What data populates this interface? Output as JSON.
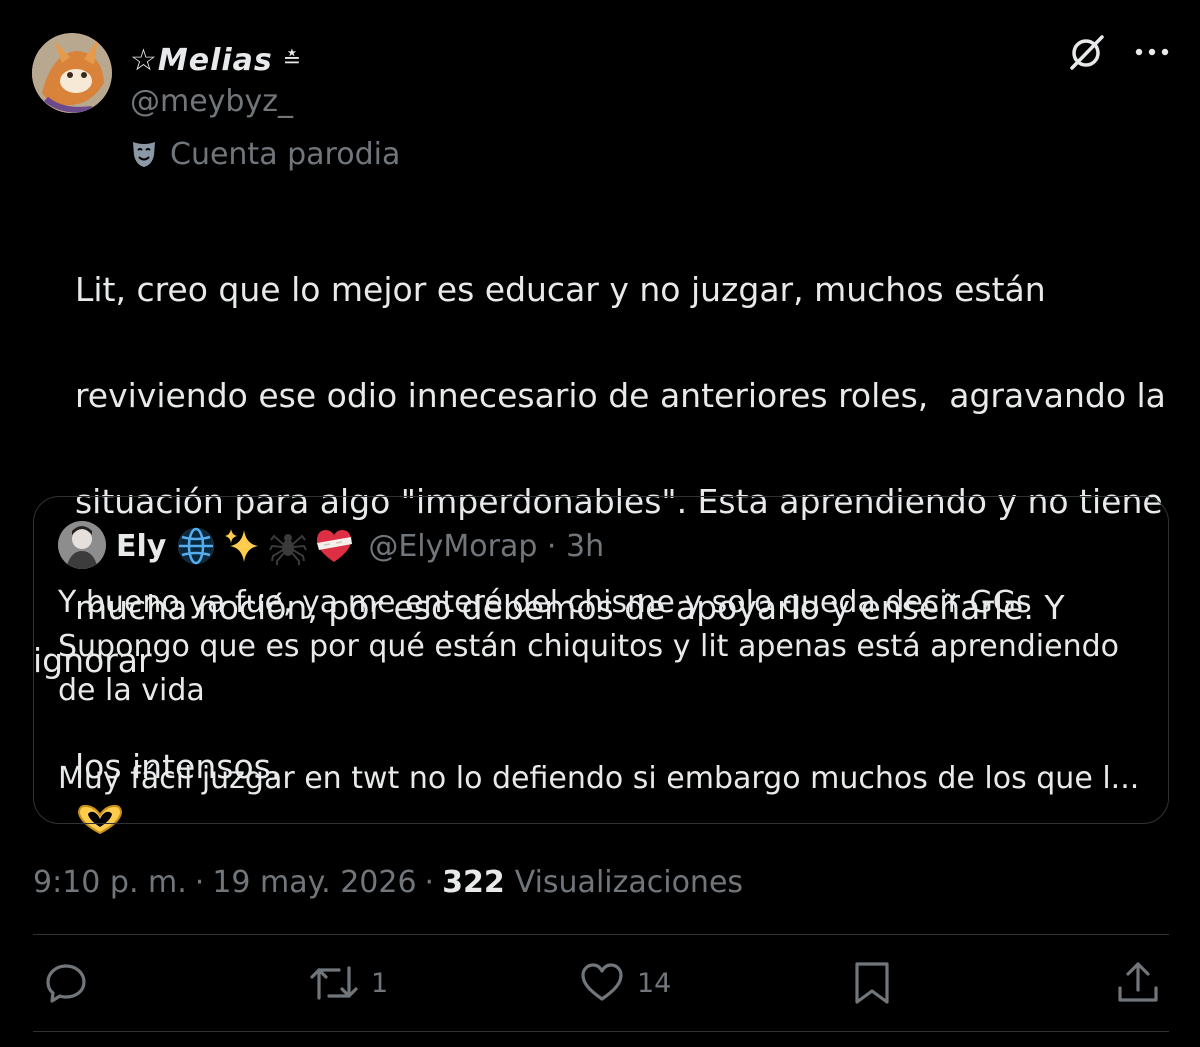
{
  "author": {
    "display_name": "☆Melias",
    "name_badge": "≛",
    "handle": "@meybyz_",
    "parody_label": "Cuenta parodia"
  },
  "tweet": {
    "text": "Lit, creo que lo mejor es educar y no juzgar, muchos están reviviendo ese odio innecesario de anteriores roles,  agravando la situación para algo \"imperdonables\". Esta aprendiendo y no tiene mucha noción, por eso debemos de apoyarlo y enseñarle. Y ignorar los intensos.",
    "line_1": "Lit, creo que lo mejor es educar y no juzgar, muchos están",
    "line_2": "reviviendo ese odio innecesario de anteriores roles,  agravando la",
    "line_3": "situación para algo \"imperdonables\". Esta aprendiendo y no tiene",
    "line_4": "mucha noción, por eso debemos de apoyarlo y enseñarle. Y ignorar",
    "line_5": "los intensos.",
    "emoji_icon": "heart-hands-icon"
  },
  "quote": {
    "name": "Ely",
    "emojis": [
      "globe-icon",
      "sparkles-icon",
      "spider-icon",
      "heart-bandage-icon"
    ],
    "handle_time": "@ElyMorap · 3h",
    "line_1": "Y bueno ya fue, ya me enteré del chisme y solo queda decir GGs",
    "line_2": "Supongo que es por qué están chiquitos y lit apenas está aprendiendo",
    "line_3": "de la vida",
    "line_4": "Muy fácil juzgar en twt no lo defiendo si embargo muchos de los que l..."
  },
  "meta": {
    "time": "9:10 p. m.",
    "date": "19 may. 2026",
    "views_count": "322",
    "views_label": "Visualizaciones",
    "separator": "·"
  },
  "actions": {
    "reply_count": "",
    "retweet_count": "1",
    "like_count": "14"
  },
  "colors": {
    "background": "#000000",
    "text": "#e7e9ea",
    "muted": "#71767b",
    "border": "#2f3336",
    "heart_hands": "#ffcc4d"
  }
}
